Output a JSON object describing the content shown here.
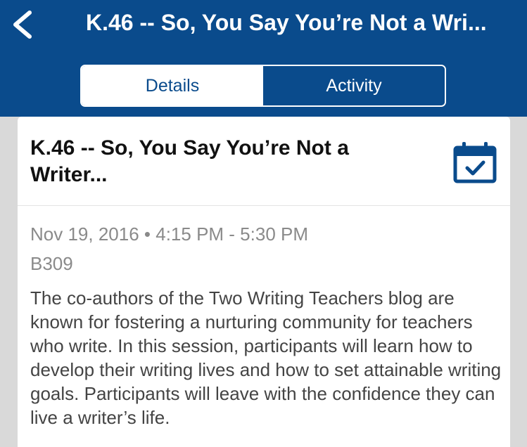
{
  "header": {
    "back_icon": "chevron-left-icon",
    "title": "K.46 -- So, You Say You’re Not a Wri..."
  },
  "tabs": [
    {
      "label": "Details",
      "active": true
    },
    {
      "label": "Activity",
      "active": false
    }
  ],
  "session": {
    "title": "K.46 -- So, You Say You’re Not a Writer...",
    "calendar_icon": "calendar-check-icon",
    "date": "Nov 19, 2016",
    "separator": "•",
    "time": "4:15 PM - 5:30 PM",
    "room": "B309",
    "description": "The co-authors of the Two Writing Teachers blog are known for fostering a nurturing community for teachers who write. In this session, participants will learn how to develop their writing lives and how to set attainable writing goals. Participants will leave with the confidence they can live a writer’s life."
  },
  "colors": {
    "nav_background": "#0a4b8c",
    "page_background": "#d9d9d9",
    "card_background": "#ffffff",
    "meta_text": "#8a8a8a"
  }
}
